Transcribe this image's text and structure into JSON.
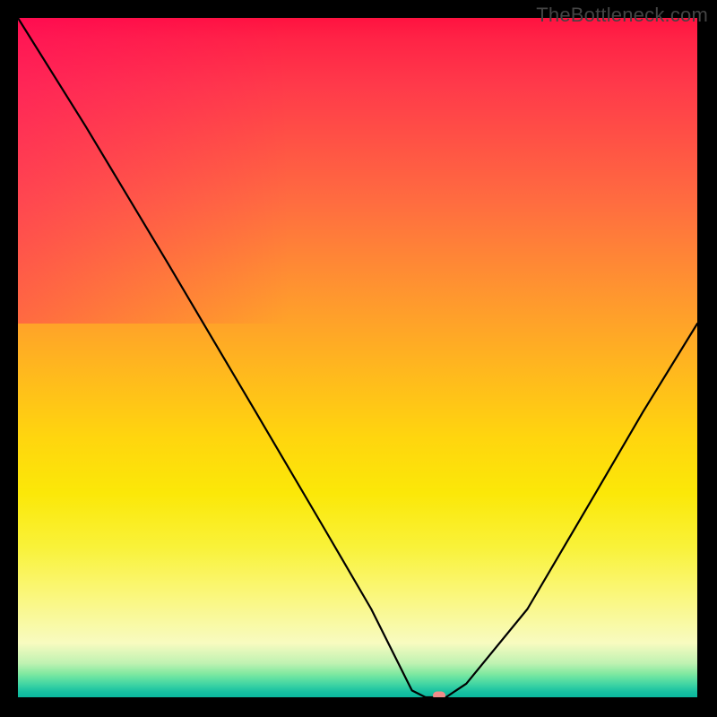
{
  "watermark": "TheBottleneck.com",
  "chart_data": {
    "type": "line",
    "title": "",
    "xlabel": "",
    "ylabel": "",
    "xlim": [
      0,
      100
    ],
    "ylim": [
      0,
      100
    ],
    "grid": false,
    "series": [
      {
        "name": "bottleneck-curve",
        "x": [
          0,
          10,
          22,
          35,
          45,
          52,
          56,
          58,
          60,
          63,
          66,
          75,
          85,
          92,
          100
        ],
        "values": [
          100,
          84,
          64,
          42,
          25,
          13,
          5,
          1,
          0,
          0,
          2,
          13,
          30,
          42,
          55
        ]
      }
    ],
    "marker": {
      "x": 62,
      "y": 0
    },
    "background_gradient": {
      "stops": [
        {
          "pos": 0,
          "color": "#ff1240"
        },
        {
          "pos": 0.27,
          "color": "#ff6c40"
        },
        {
          "pos": 0.52,
          "color": "#ffb81e"
        },
        {
          "pos": 0.78,
          "color": "#f9f23a"
        },
        {
          "pos": 0.95,
          "color": "#bff2b2"
        },
        {
          "pos": 1.0,
          "color": "#0ab89e"
        }
      ]
    }
  }
}
